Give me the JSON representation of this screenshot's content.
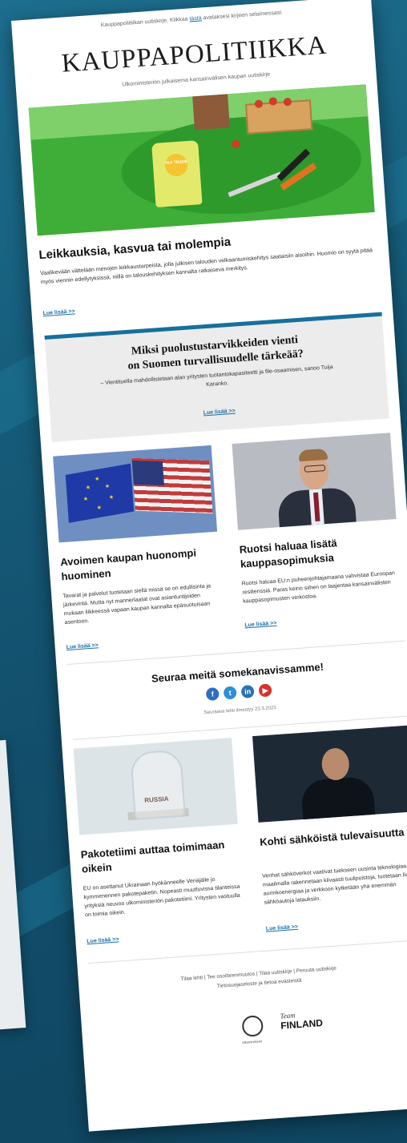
{
  "preheader": {
    "text_before": "Kauppapoliitiikan uutiskirje. Klikkaa",
    "link": "tästä",
    "text_after": "avataksesi kirjeen selaimessasi."
  },
  "masthead": {
    "title": "KAUPPAPOLITIIKKA",
    "tagline": "Ulkoministeriön julkaisema kansainvälisen kaupan uutiskirje"
  },
  "hero": {
    "bag_label": "TAX TRADE"
  },
  "lead_article": {
    "title": "Leikkauksia, kasvua tai molempia",
    "body": "Vaalikevään vättelään menojen leikkaustarpeista, jolla julkisen talouden velkaantumiskehitys saataisiin aisoihin. Huomio on syytä pitää myös viennin edellytyksissä, niillä on talouskehityksen kannalta ratkaiseva merkitys.",
    "more": "Lue lisää >>"
  },
  "feature": {
    "title_line1": "Miksi puolustustarvikkeiden vienti",
    "title_line2": "on Suomen turvallisuudelle tärkeää?",
    "subtitle": "– Vientituella mahdollistetaan alan yritysten tuotantokapasiteetti ja file-osaamisen, sanoo Tuija Karanko.",
    "more": "Lue lisää >>"
  },
  "columns_1": [
    {
      "title": "Avoimen kaupan huonompi huominen",
      "body": "Tavarat ja palvelut tuotetaan siellä missä se on edullisinta ja järkevintä. Mutta nyt mannerlaatat ovat asiantuntijoiden mukaan liikkeessä vapaan kaupan kannalta epäsuotuisaan asentoon.",
      "more": "Lue lisää >>"
    },
    {
      "title": "Ruotsi haluaa lisätä kauppasopimuksia",
      "body": "Ruotsi haluaa EU:n puheenjohtajamaana vahvistaa Euroopan resilienssiä. Paras keino siihen on laajentaa kansainvälisten kauppasopimusten verkostoa.",
      "more": "Lue lisää >>"
    }
  ],
  "social": {
    "title": "Seuraa meitä somekanavissamme!",
    "icons": [
      "facebook-icon",
      "twitter-icon",
      "linkedin-icon",
      "youtube-icon"
    ],
    "next_issue": "Seuraava lehti ilmestyy 23.3.2023"
  },
  "columns_2": [
    {
      "title": "Pakotetiimi auttaa toimimaan oikein",
      "image_label": "RUSSIA",
      "body": "EU on asettanut Ukrainaan hyökänneelle Venäjälle jo kymmenennen pakotepaketin. Nopeasti muuttuvissa tilanteissa yrityksiä neuvoo ulkoministeriön pakotetiimi. Yritysten vastuulla on toimia oikein.",
      "more": "Lue lisää >>"
    },
    {
      "title": "Kohti sähköistä tulevaisuutta",
      "body": "Venhat sähköverkot vaativat tuekseen uusinta teknologiaa, kun maailmalla rakennetaan kiivaasti tuulipuistoja, tuotetaan lisää aurinkoenergiaa ja verkkoon kytketään yhä enemmän sähköautoja latauksiin.",
      "more": "Lue lisää >>"
    }
  ],
  "footer": {
    "line1": "Tilaa lehti | Tee osoitteenmuutos | Tilaa uutiskirje | Peruuta uutiskirje",
    "line2": "Tietosuojaseloste ja tietoa evästeistä",
    "seal_caption": "Ulkoministeriö",
    "team_script": "Team",
    "team_word": "FINLAND"
  },
  "colors": {
    "accent": "#176f9c",
    "link": "#1c6fa8",
    "background": "#155a78"
  }
}
